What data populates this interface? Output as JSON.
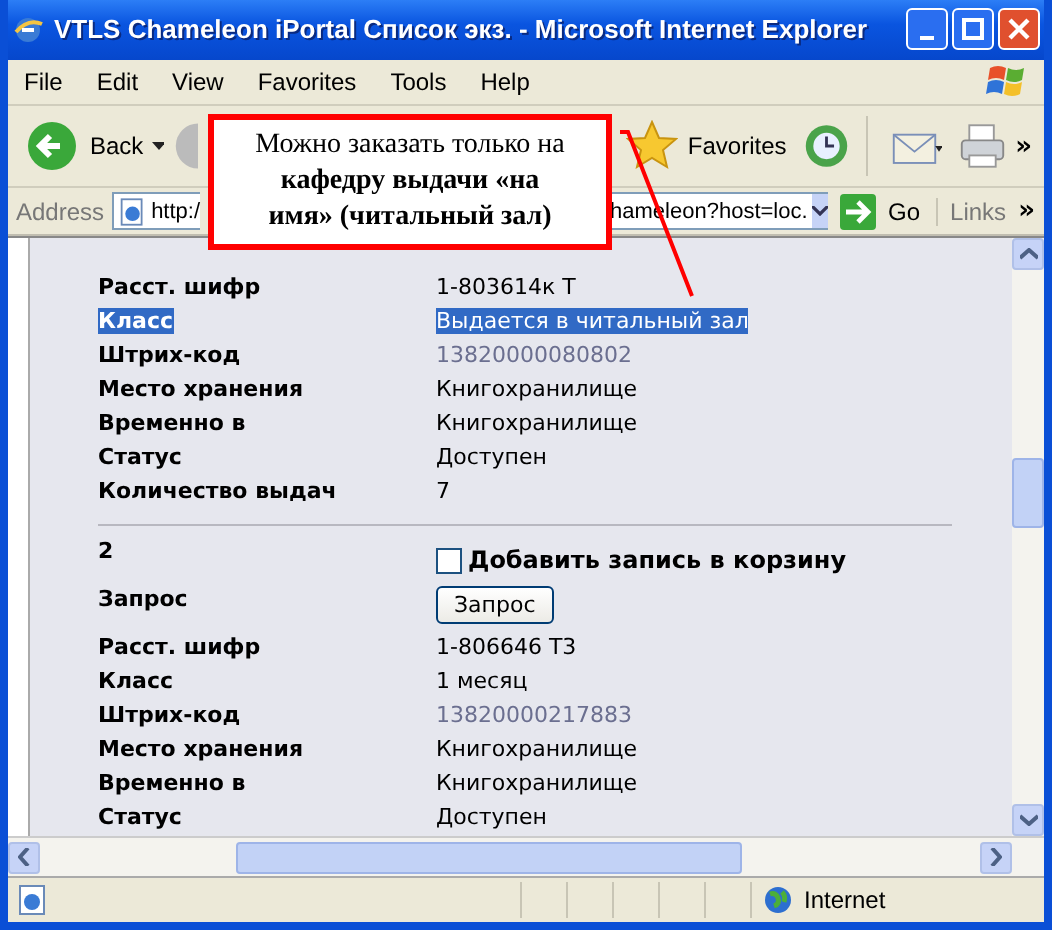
{
  "window": {
    "title": "VTLS Chameleon iPortal Список экз. - Microsoft Internet Explorer"
  },
  "menu": [
    "File",
    "Edit",
    "View",
    "Favorites",
    "Tools",
    "Help"
  ],
  "toolbar": {
    "back": "Back",
    "favorites": "Favorites",
    "more": "»"
  },
  "address_bar": {
    "label": "Address",
    "value_parts": [
      "http:/",
      "hameleon?host=loc."
    ],
    "go": "Go",
    "links": "Links",
    "more": "»"
  },
  "records": [
    {
      "fields": [
        {
          "label": "Расст. шифр",
          "value": "1-803614к Т",
          "kind": "text",
          "selected": false
        },
        {
          "label": "Класс",
          "value": "Выдается в читальный зал",
          "kind": "text",
          "selected": true
        },
        {
          "label": "Штрих-код",
          "value": "13820000080802",
          "kind": "barcode",
          "selected": false
        },
        {
          "label": "Место хранения",
          "value": "Книгохранилище",
          "kind": "text",
          "selected": false
        },
        {
          "label": "Временно в",
          "value": "Книгохранилище",
          "kind": "text",
          "selected": false
        },
        {
          "label": "Статус",
          "value": "Доступен",
          "kind": "text",
          "selected": false
        },
        {
          "label": "Количество выдач",
          "value": "7",
          "kind": "text",
          "selected": false
        }
      ]
    },
    {
      "number": "2",
      "basket": {
        "label": "Добавить запись в корзину",
        "checked": false
      },
      "request": {
        "label": "Запрос",
        "button": "Запрос"
      },
      "fields": [
        {
          "label": "Расст. шифр",
          "value": "1-806646 Т3",
          "kind": "text",
          "selected": false
        },
        {
          "label": "Класс",
          "value": "1 месяц",
          "kind": "text",
          "selected": false
        },
        {
          "label": "Штрих-код",
          "value": "13820000217883",
          "kind": "barcode",
          "selected": false
        },
        {
          "label": "Место хранения",
          "value": "Книгохранилище",
          "kind": "text",
          "selected": false
        },
        {
          "label": "Временно в",
          "value": "Книгохранилище",
          "kind": "text",
          "selected": false
        },
        {
          "label": "Статус",
          "value": "Доступен",
          "kind": "text",
          "selected": false
        }
      ]
    }
  ],
  "status_bar": {
    "zone": "Internet"
  },
  "callout": {
    "text": "Можно заказать только на **кафедру выдачи «на имя» (читальный зал)**"
  }
}
